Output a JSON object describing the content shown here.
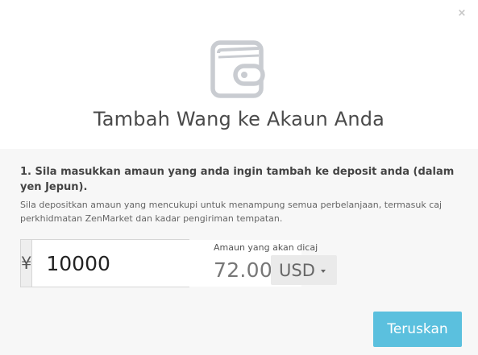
{
  "modal": {
    "close_glyph": "×",
    "icon": "wallet-icon",
    "title": "Tambah Wang ke Akaun Anda"
  },
  "step": {
    "title": "1. Sila masukkan amaun yang anda ingin tambah ke deposit anda (dalam yen Jepun).",
    "description": "Sila depositkan amaun yang mencukupi untuk menampung semua perbelanjaan, termasuk caj perkhidmatan ZenMarket dan kadar pengiriman tempatan."
  },
  "amount": {
    "currency_symbol": "¥",
    "value": "10000"
  },
  "charge": {
    "label": "Amaun yang akan dicaj",
    "value": "72.00",
    "currency": "USD"
  },
  "actions": {
    "continue_label": "Teruskan"
  },
  "colors": {
    "primary_button": "#5bc0de",
    "body_background": "#f7f7f7",
    "icon_stroke": "#c9ccd1"
  }
}
